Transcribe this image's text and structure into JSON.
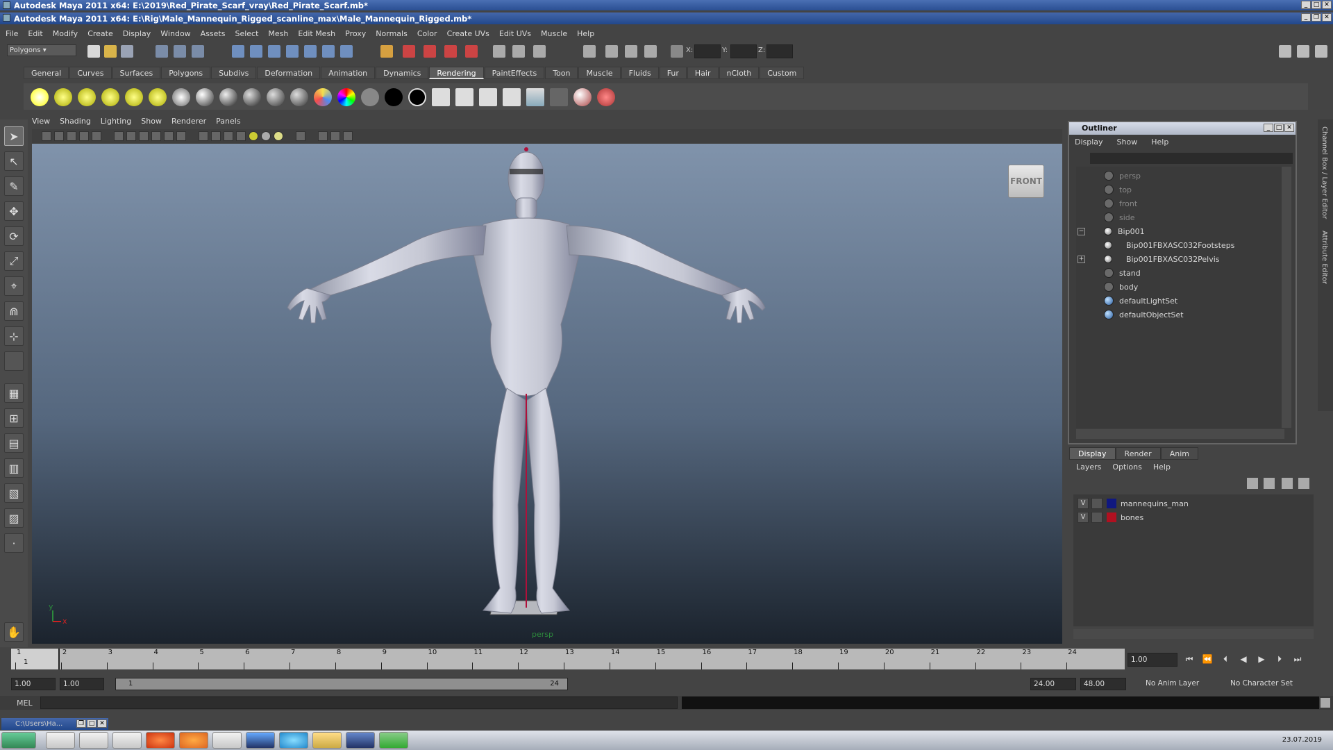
{
  "window": {
    "outer_title": "Autodesk Maya 2011 x64: E:\\2019\\Red_Pirate_Scarf_vray\\Red_Pirate_Scarf.mb*",
    "inner_title": "Autodesk Maya 2011 x64: E:\\Rig\\Male_Mannequin_Rigged_scanline_max\\Male_Mannequin_Rigged.mb*"
  },
  "menubar": [
    "File",
    "Edit",
    "Modify",
    "Create",
    "Display",
    "Window",
    "Assets",
    "Select",
    "Mesh",
    "Edit Mesh",
    "Proxy",
    "Normals",
    "Color",
    "Create UVs",
    "Edit UVs",
    "Muscle",
    "Help"
  ],
  "statusline": {
    "mode": "Polygons",
    "x_label": "X:",
    "y_label": "Y:",
    "z_label": "Z:"
  },
  "shelf": {
    "tabs": [
      "General",
      "Curves",
      "Surfaces",
      "Polygons",
      "Subdivs",
      "Deformation",
      "Animation",
      "Dynamics",
      "Rendering",
      "PaintEffects",
      "Toon",
      "Muscle",
      "Fluids",
      "Fur",
      "Hair",
      "nCloth",
      "Custom"
    ],
    "active_tab": "Rendering"
  },
  "viewport": {
    "menus": [
      "View",
      "Shading",
      "Lighting",
      "Show",
      "Renderer",
      "Panels"
    ],
    "viewcube_label": "FRONT",
    "camera_label": "persp",
    "axis_y": "y",
    "axis_x": "x"
  },
  "outliner": {
    "title": "Outliner",
    "menus": [
      "Display",
      "Show",
      "Help"
    ],
    "items": [
      {
        "label": "persp",
        "dim": true
      },
      {
        "label": "top",
        "dim": true
      },
      {
        "label": "front",
        "dim": true
      },
      {
        "label": "side",
        "dim": true
      },
      {
        "label": "Bip001"
      },
      {
        "label": "Bip001FBXASC032Footsteps"
      },
      {
        "label": "Bip001FBXASC032Pelvis"
      },
      {
        "label": "stand"
      },
      {
        "label": "body"
      },
      {
        "label": "defaultLightSet"
      },
      {
        "label": "defaultObjectSet"
      }
    ]
  },
  "side_tabs": [
    "Channel Box / Layer Editor",
    "Attribute Editor"
  ],
  "layer_editor": {
    "tabs": [
      "Display",
      "Render",
      "Anim"
    ],
    "active_tab": "Display",
    "menus": [
      "Layers",
      "Options",
      "Help"
    ],
    "layers": [
      {
        "visible": "V",
        "name": "mannequins_man",
        "color": "#101880"
      },
      {
        "visible": "V",
        "name": "bones",
        "color": "#b01020"
      }
    ]
  },
  "timeline": {
    "ticks": [
      "1",
      "2",
      "3",
      "4",
      "5",
      "6",
      "7",
      "8",
      "9",
      "10",
      "11",
      "12",
      "13",
      "14",
      "15",
      "16",
      "17",
      "18",
      "19",
      "20",
      "21",
      "22",
      "23",
      "24"
    ],
    "current_frame": "1",
    "current_time_field": "1.00"
  },
  "range": {
    "start_time": "1.00",
    "playback_start": "1.00",
    "slider_start": "1",
    "slider_end": "24",
    "playback_end": "24.00",
    "end_time": "48.00",
    "anim_layer": "No Anim Layer",
    "character_set": "No Character Set"
  },
  "command": {
    "label": "MEL"
  },
  "minimized_window": {
    "label": "C:\\Users\\Ha..."
  },
  "taskbar": {
    "date": "23.07.2019"
  }
}
